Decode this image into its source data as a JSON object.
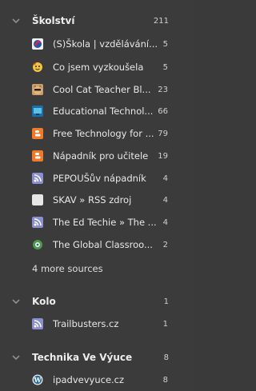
{
  "folders": [
    {
      "title": "Školství",
      "count": "211",
      "feeds": [
        {
          "title": "(S)Škola | vzdělávání...",
          "count": "5",
          "icon": "sskola-icon"
        },
        {
          "title": "Co jsem vyzkoušela",
          "count": "5",
          "icon": "emoji-face-icon"
        },
        {
          "title": "Cool Cat Teacher Bl...",
          "count": "23",
          "icon": "cool-cat-icon"
        },
        {
          "title": "Educational Technol...",
          "count": "66",
          "icon": "edtech-icon"
        },
        {
          "title": "Free Technology for ...",
          "count": "79",
          "icon": "blogger-icon"
        },
        {
          "title": "Nápadník pro učitele",
          "count": "19",
          "icon": "blogger-icon"
        },
        {
          "title": "PEPOUŠův nápadník",
          "count": "4",
          "icon": "rss-icon"
        },
        {
          "title": "SKAV » RSS zdroj",
          "count": "4",
          "icon": "blank-icon"
        },
        {
          "title": "The Ed Techie » The ...",
          "count": "4",
          "icon": "rss-icon"
        },
        {
          "title": "The Global Classroo...",
          "count": "2",
          "icon": "globe-icon"
        }
      ],
      "more": "4 more sources"
    },
    {
      "title": "Kolo",
      "count": "1",
      "feeds": [
        {
          "title": "Trailbusters.cz",
          "count": "1",
          "icon": "rss-icon"
        }
      ]
    },
    {
      "title": "Technika Ve Výuce",
      "count": "8",
      "feeds": [
        {
          "title": "ipadvevyuce.cz",
          "count": "8",
          "icon": "wordpress-icon"
        }
      ]
    }
  ],
  "colors": {
    "background": "#3b3b3b",
    "text": "#e8e8e8",
    "count": "#d0d0d0",
    "chevron": "#8f8f8f"
  }
}
